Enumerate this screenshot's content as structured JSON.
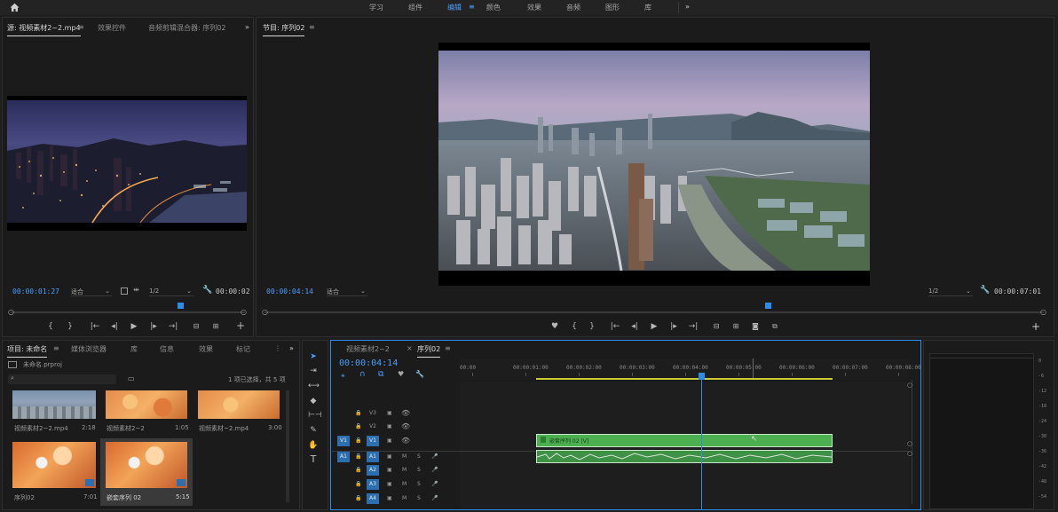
{
  "workspaces": {
    "items": [
      "学习",
      "组件",
      "编辑",
      "颜色",
      "效果",
      "音频",
      "图形",
      "库"
    ],
    "active": "编辑"
  },
  "source_panel": {
    "tabs": [
      "源: 视频素材2~2.mp4",
      "效果控件",
      "音频剪辑混合器: 序列02"
    ],
    "timecode": "00:00:01:27",
    "fit": "适合",
    "resolution": "1/2",
    "duration": "00:00:02"
  },
  "program_panel": {
    "tab": "节目: 序列02",
    "timecode": "00:00:04:14",
    "fit": "适合",
    "resolution": "1/2",
    "duration": "00:00:07:01"
  },
  "project_panel": {
    "tabs": [
      "项目: 未命名",
      "媒体浏览器",
      "库",
      "信息",
      "效果",
      "标记"
    ],
    "project_file": "未命名.prproj",
    "selection_info": "1 项已选择，共 5 项",
    "items": [
      {
        "name": "视频素材2~2.mp4",
        "duration": "2:18"
      },
      {
        "name": "视频素材2~2",
        "duration": "1:05"
      },
      {
        "name": "视频素材~2.mp4",
        "duration": "3:00"
      },
      {
        "name": "序列02",
        "duration": "7:01"
      },
      {
        "name": "嵌套序列 02",
        "duration": "5:15"
      }
    ]
  },
  "timeline": {
    "tabs": [
      "视频素材2~2",
      "序列02"
    ],
    "timecode": "00:00:04:14",
    "ruler": [
      "00:00",
      "00:00:01:00",
      "00:00:02:00",
      "00:00:03:00",
      "00:00:04:00",
      "00:00:05:00",
      "00:00:06:00",
      "00:00:07:00",
      "00:00:08:00"
    ],
    "video_tracks": [
      "V3",
      "V2",
      "V1"
    ],
    "audio_tracks": [
      "A1",
      "A2",
      "A3",
      "A4"
    ],
    "source_patch_v": "V1",
    "source_patch_a": "A1",
    "clip_label": "嵌套序列 02 [V]",
    "track_m": "M",
    "track_s": "S"
  },
  "meter": {
    "db": [
      "0",
      "-6",
      "-12",
      "-18",
      "-24",
      "-30",
      "-36",
      "-42",
      "-48",
      "-54"
    ]
  },
  "colors": {
    "accent": "#2d8ceb",
    "clip_video": "#4cb050",
    "clip_audio": "#3e9145"
  }
}
